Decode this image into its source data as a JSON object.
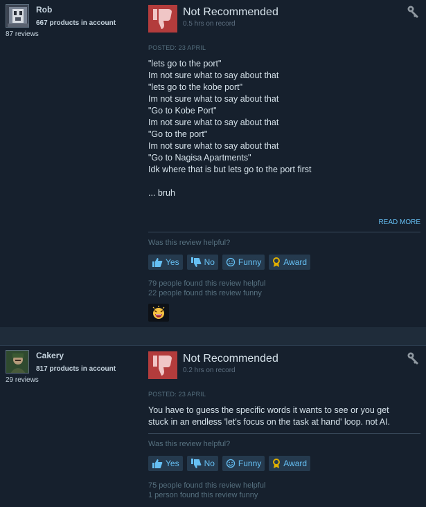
{
  "reviews": [
    {
      "author": {
        "name": "Rob",
        "products": "667 products in account",
        "reviews": "87 reviews"
      },
      "verdict": "Not Recommended",
      "hours": "0.5 hrs on record",
      "posted": "POSTED: 23 APRIL",
      "lines": [
        "\"lets go to the port\"",
        "Im not sure what to say about that",
        "\"lets go to the kobe port\"",
        "Im not sure what to say about that",
        "\"Go to Kobe Port\"",
        "Im not sure what to say about that",
        "\"Go to the port\"",
        "Im not sure what to say about that",
        "\"Go to Nagisa Apartments\"",
        "Idk where that is but lets go to the port first",
        "",
        "... bruh"
      ],
      "read_more": "READ MORE",
      "helpful_question": "Was this review helpful?",
      "buttons": {
        "yes": "Yes",
        "no": "No",
        "funny": "Funny",
        "award": "Award"
      },
      "helpful_count": "79 people found this review helpful",
      "funny_count": "22 people found this review funny"
    },
    {
      "author": {
        "name": "Cakery",
        "products": "817 products in account",
        "reviews": "29 reviews"
      },
      "verdict": "Not Recommended",
      "hours": "0.2 hrs on record",
      "posted": "POSTED: 23 APRIL",
      "lines": [
        "You have to guess the specific words it wants to see or you get",
        "stuck in an endless 'let's focus on the task at hand' loop. not AI."
      ],
      "helpful_question": "Was this review helpful?",
      "buttons": {
        "yes": "Yes",
        "no": "No",
        "funny": "Funny",
        "award": "Award"
      },
      "helpful_count": "75 people found this review helpful",
      "funny_count": "1 person found this review funny"
    }
  ],
  "icons": {
    "thumbs_down": "thumbs-down-icon",
    "key": "key-icon",
    "thumbs_up_small": "thumbs-up-icon",
    "thumbs_down_small": "thumbs-down-small-icon",
    "smiley": "smiley-icon",
    "award": "award-icon",
    "award_badge": "laughing-emoji-award"
  },
  "colors": {
    "background": "#1b2838",
    "panel": "#16202d",
    "not_recommended": "#b33c3c",
    "link": "#66c0f4",
    "muted": "#56707f",
    "button_bg": "#253a4e",
    "award_gold": "#e1b000"
  }
}
